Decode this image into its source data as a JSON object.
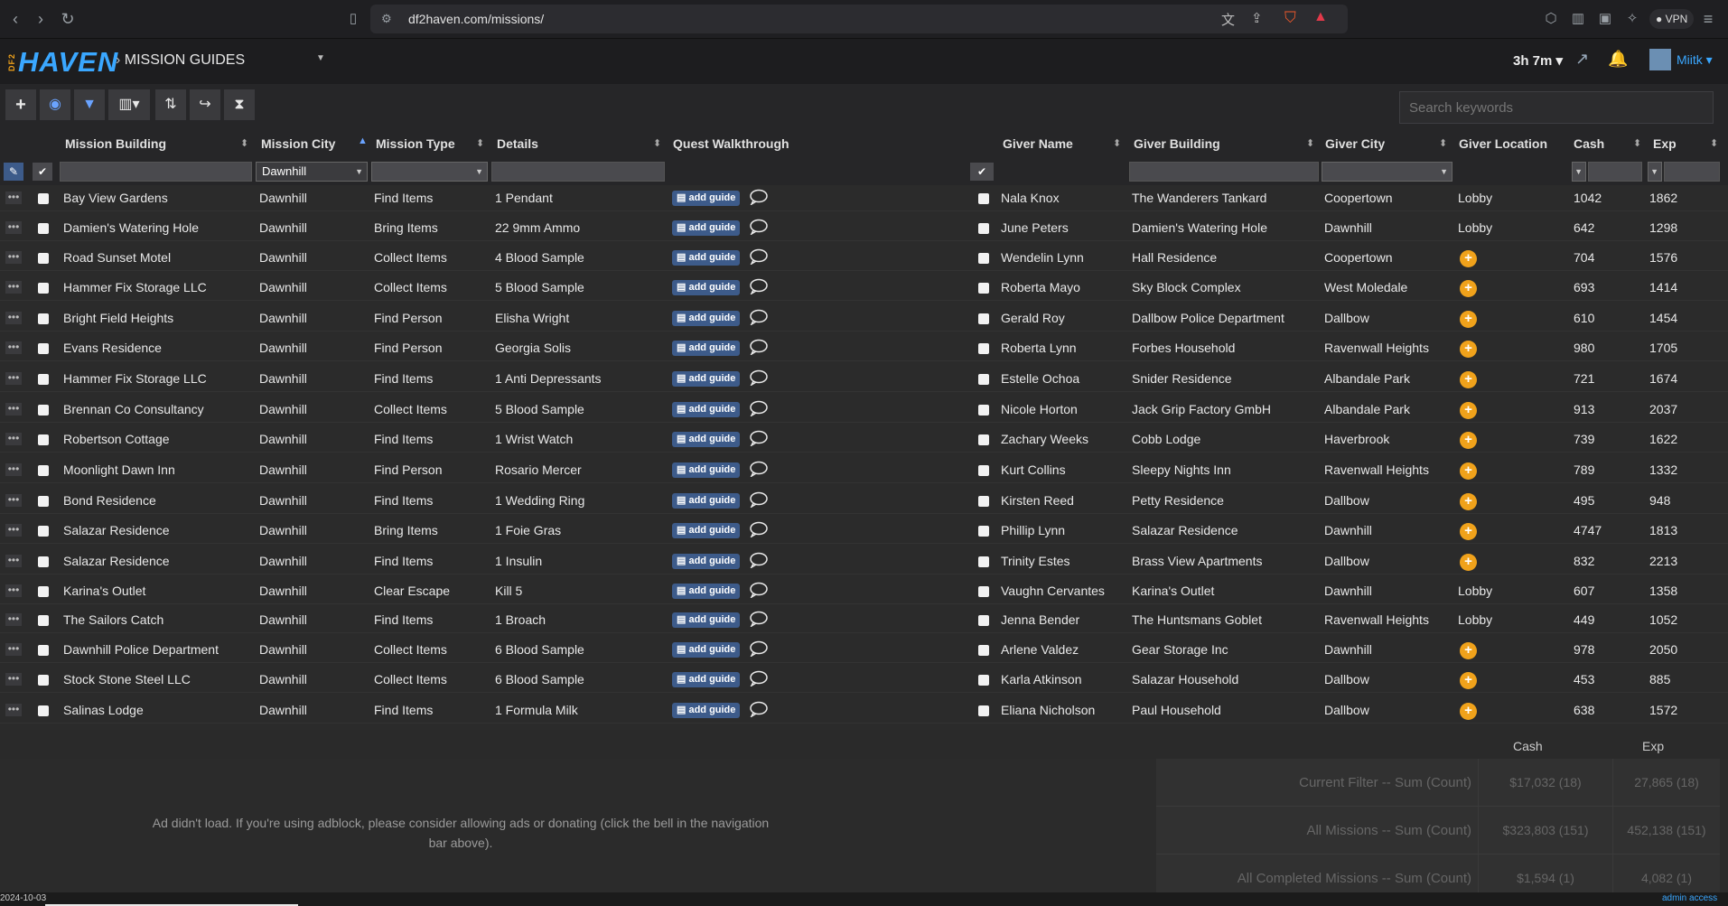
{
  "browser": {
    "url": "df2haven.com/missions/",
    "vpn_label": "VPN"
  },
  "app": {
    "logo_text": "HAVEN",
    "logo_sub": "DF2",
    "breadcrumb": "MISSION GUIDES",
    "timer": "3h 7m",
    "username": "Miitk"
  },
  "search": {
    "placeholder": "Search keywords"
  },
  "columns": {
    "mission_building": "Mission Building",
    "mission_city": "Mission City",
    "mission_type": "Mission Type",
    "details": "Details",
    "quest_walkthrough": "Quest Walkthrough",
    "giver_name": "Giver Name",
    "giver_building": "Giver Building",
    "giver_city": "Giver City",
    "giver_location": "Giver Location",
    "cash": "Cash",
    "exp": "Exp"
  },
  "filters": {
    "mission_city": "Dawnhill"
  },
  "add_guide_label": "add guide",
  "rows": [
    {
      "building": "Bay View Gardens",
      "city": "Dawnhill",
      "type": "Find Items",
      "details": "1 Pendant",
      "giver": "Nala Knox",
      "giver_building": "The Wanderers Tankard",
      "giver_city": "Coopertown",
      "location": "Lobby",
      "cash": "1042",
      "exp": "1862"
    },
    {
      "building": "Damien's Watering Hole",
      "city": "Dawnhill",
      "type": "Bring Items",
      "details": "22 9mm Ammo",
      "giver": "June Peters",
      "giver_building": "Damien's Watering Hole",
      "giver_city": "Dawnhill",
      "location": "Lobby",
      "cash": "642",
      "exp": "1298"
    },
    {
      "building": "Road Sunset Motel",
      "city": "Dawnhill",
      "type": "Collect Items",
      "details": "4 Blood Sample",
      "giver": "Wendelin Lynn",
      "giver_building": "Hall Residence",
      "giver_city": "Coopertown",
      "location": "+",
      "cash": "704",
      "exp": "1576"
    },
    {
      "building": "Hammer Fix Storage LLC",
      "city": "Dawnhill",
      "type": "Collect Items",
      "details": "5 Blood Sample",
      "giver": "Roberta Mayo",
      "giver_building": "Sky Block Complex",
      "giver_city": "West Moledale",
      "location": "+",
      "cash": "693",
      "exp": "1414"
    },
    {
      "building": "Bright Field Heights",
      "city": "Dawnhill",
      "type": "Find Person",
      "details": "Elisha Wright",
      "giver": "Gerald Roy",
      "giver_building": "Dallbow Police Department",
      "giver_city": "Dallbow",
      "location": "+",
      "cash": "610",
      "exp": "1454"
    },
    {
      "building": "Evans Residence",
      "city": "Dawnhill",
      "type": "Find Person",
      "details": "Georgia Solis",
      "giver": "Roberta Lynn",
      "giver_building": "Forbes Household",
      "giver_city": "Ravenwall Heights",
      "location": "+",
      "cash": "980",
      "exp": "1705"
    },
    {
      "building": "Hammer Fix Storage LLC",
      "city": "Dawnhill",
      "type": "Find Items",
      "details": "1 Anti Depressants",
      "giver": "Estelle Ochoa",
      "giver_building": "Snider Residence",
      "giver_city": "Albandale Park",
      "location": "+",
      "cash": "721",
      "exp": "1674"
    },
    {
      "building": "Brennan Co Consultancy",
      "city": "Dawnhill",
      "type": "Collect Items",
      "details": "5 Blood Sample",
      "giver": "Nicole Horton",
      "giver_building": "Jack Grip Factory GmbH",
      "giver_city": "Albandale Park",
      "location": "+",
      "cash": "913",
      "exp": "2037"
    },
    {
      "building": "Robertson Cottage",
      "city": "Dawnhill",
      "type": "Find Items",
      "details": "1 Wrist Watch",
      "giver": "Zachary Weeks",
      "giver_building": "Cobb Lodge",
      "giver_city": "Haverbrook",
      "location": "+",
      "cash": "739",
      "exp": "1622"
    },
    {
      "building": "Moonlight Dawn Inn",
      "city": "Dawnhill",
      "type": "Find Person",
      "details": "Rosario Mercer",
      "giver": "Kurt Collins",
      "giver_building": "Sleepy Nights Inn",
      "giver_city": "Ravenwall Heights",
      "location": "+",
      "cash": "789",
      "exp": "1332"
    },
    {
      "building": "Bond Residence",
      "city": "Dawnhill",
      "type": "Find Items",
      "details": "1 Wedding Ring",
      "giver": "Kirsten Reed",
      "giver_building": "Petty Residence",
      "giver_city": "Dallbow",
      "location": "+",
      "cash": "495",
      "exp": "948"
    },
    {
      "building": "Salazar Residence",
      "city": "Dawnhill",
      "type": "Bring Items",
      "details": "1 Foie Gras",
      "giver": "Phillip Lynn",
      "giver_building": "Salazar Residence",
      "giver_city": "Dawnhill",
      "location": "+",
      "cash": "4747",
      "exp": "1813"
    },
    {
      "building": "Salazar Residence",
      "city": "Dawnhill",
      "type": "Find Items",
      "details": "1 Insulin",
      "giver": "Trinity Estes",
      "giver_building": "Brass View Apartments",
      "giver_city": "Dallbow",
      "location": "+",
      "cash": "832",
      "exp": "2213"
    },
    {
      "building": "Karina's Outlet",
      "city": "Dawnhill",
      "type": "Clear Escape",
      "details": "Kill 5",
      "giver": "Vaughn Cervantes",
      "giver_building": "Karina's Outlet",
      "giver_city": "Dawnhill",
      "location": "Lobby",
      "cash": "607",
      "exp": "1358"
    },
    {
      "building": "The Sailors Catch",
      "city": "Dawnhill",
      "type": "Find Items",
      "details": "1 Broach",
      "giver": "Jenna Bender",
      "giver_building": "The Huntsmans Goblet",
      "giver_city": "Ravenwall Heights",
      "location": "Lobby",
      "cash": "449",
      "exp": "1052"
    },
    {
      "building": "Dawnhill Police Department",
      "city": "Dawnhill",
      "type": "Collect Items",
      "details": "6 Blood Sample",
      "giver": "Arlene Valdez",
      "giver_building": "Gear Storage Inc",
      "giver_city": "Dawnhill",
      "location": "+",
      "cash": "978",
      "exp": "2050"
    },
    {
      "building": "Stock Stone Steel LLC",
      "city": "Dawnhill",
      "type": "Collect Items",
      "details": "6 Blood Sample",
      "giver": "Karla Atkinson",
      "giver_building": "Salazar Household",
      "giver_city": "Dallbow",
      "location": "+",
      "cash": "453",
      "exp": "885"
    },
    {
      "building": "Salinas Lodge",
      "city": "Dawnhill",
      "type": "Find Items",
      "details": "1 Formula Milk",
      "giver": "Eliana Nicholson",
      "giver_building": "Paul Household",
      "giver_city": "Dallbow",
      "location": "+",
      "cash": "638",
      "exp": "1572"
    }
  ],
  "summary": {
    "cash_header": "Cash",
    "exp_header": "Exp",
    "rows": [
      {
        "label": "Current Filter -- Sum (Count)",
        "cash": "$17,032 (18)",
        "exp": "27,865 (18)"
      },
      {
        "label": "All Missions -- Sum (Count)",
        "cash": "$323,803 (151)",
        "exp": "452,138 (151)"
      },
      {
        "label": "All Completed Missions -- Sum (Count)",
        "cash": "$1,594 (1)",
        "exp": "4,082 (1)"
      }
    ]
  },
  "ad_text": "Ad didn't load. If you're using adblock, please consider allowing ads or donating (click the bell in the navigation bar above).",
  "footer": {
    "date": "2024-10-03",
    "admin": "admin access"
  },
  "colors": {
    "accent": "#3aa7ff",
    "orange": "#f0a21b",
    "guide_button": "#3d5b8a"
  }
}
